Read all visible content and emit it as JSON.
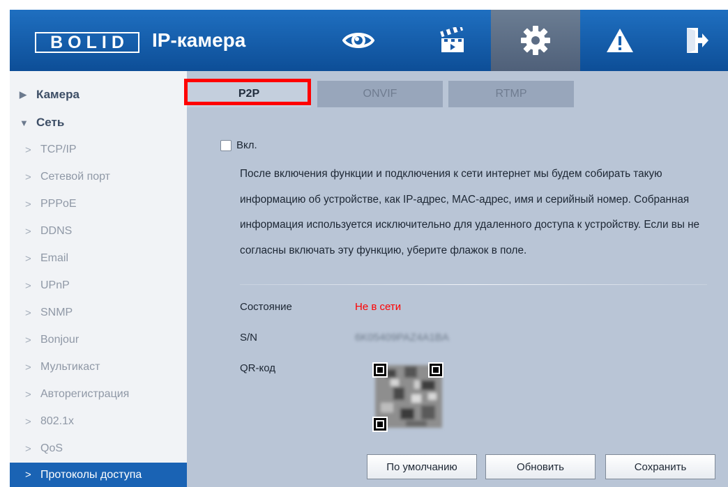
{
  "header": {
    "logo": "BOLID",
    "product": "IP-камера",
    "icons": [
      "eye-icon",
      "clapperboard-icon",
      "gear-icon",
      "warning-icon",
      "logout-icon"
    ]
  },
  "sidebar": {
    "camera": "Камера",
    "network": "Сеть",
    "items": [
      {
        "label": "TCP/IP"
      },
      {
        "label": "Сетевой порт"
      },
      {
        "label": "PPPoE"
      },
      {
        "label": "DDNS"
      },
      {
        "label": "Email"
      },
      {
        "label": "UPnP"
      },
      {
        "label": "SNMP"
      },
      {
        "label": "Bonjour"
      },
      {
        "label": "Мультикаст"
      },
      {
        "label": "Авторегистрация"
      },
      {
        "label": "802.1x"
      },
      {
        "label": "QoS"
      },
      {
        "label": "Протоколы доступа"
      }
    ]
  },
  "tabs": [
    "P2P",
    "ONVIF",
    "RTMP"
  ],
  "p2p": {
    "enable_label": "Вкл.",
    "enabled": false,
    "description": "После включения функции и подключения к сети интернет мы будем собирать такую информацию об устройстве, как IP-адрес, MAC-адрес, имя и серийный номер. Собранная информация используется исключительно для удаленного доступа к устройству. Если вы не согласны включать эту функцию, уберите флажок в поле.",
    "status_label": "Состояние",
    "status_value": "Не в сети",
    "sn_label": "S/N",
    "sn_value": "6K05409PAZ4A1BA",
    "qr_label": "QR-код"
  },
  "buttons": {
    "default": "По умолчанию",
    "refresh": "Обновить",
    "save": "Сохранить"
  },
  "colors": {
    "header": "#1660b0",
    "active_nav": "#1a63b4",
    "status_offline": "#ff0000",
    "highlight": "#ff0000"
  }
}
